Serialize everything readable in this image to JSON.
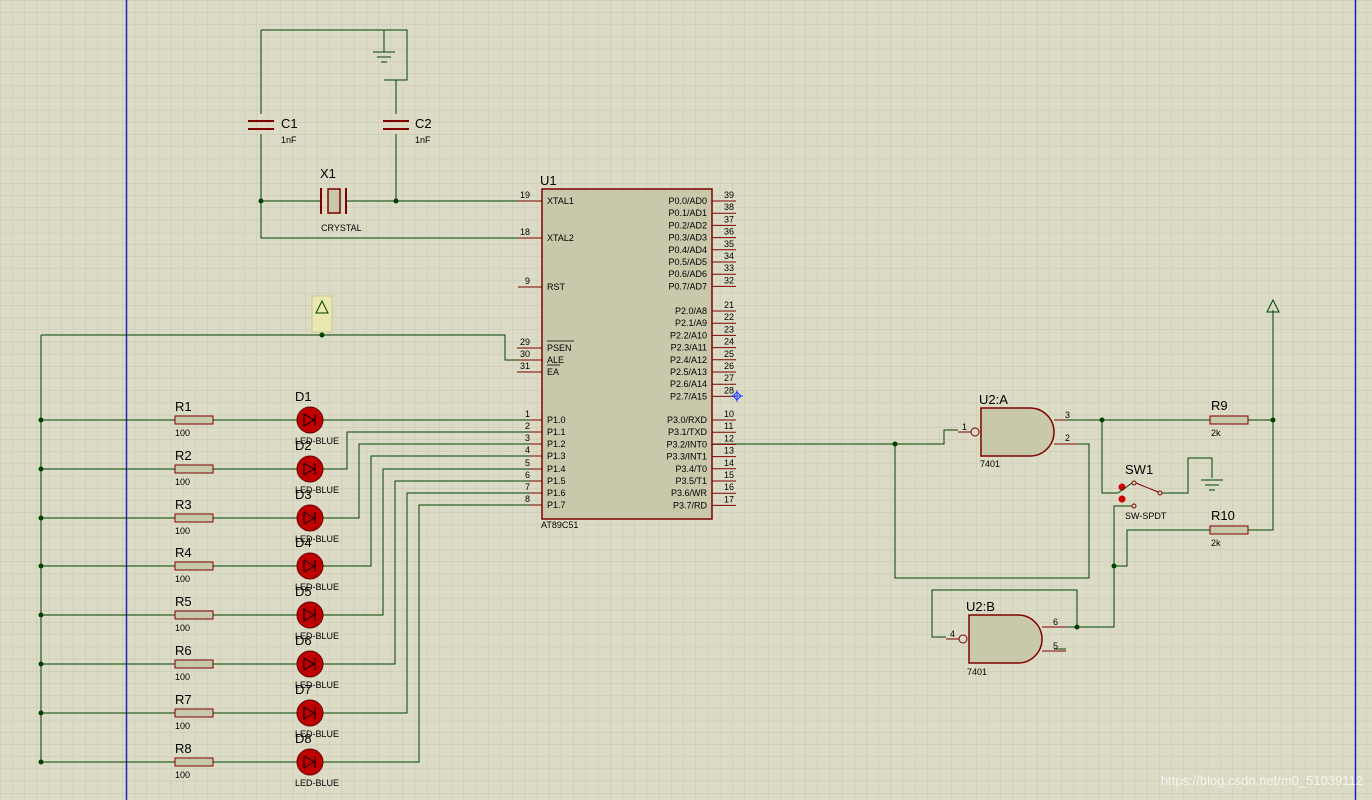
{
  "colors": {
    "background": "#dcdcc6",
    "grid": "#c8c8b4",
    "wire": "#004000",
    "body": "#c8c8aa",
    "outline": "#800000",
    "border": "#0000c0",
    "led": "#c00000"
  },
  "u1": {
    "ref": "U1",
    "part": "AT89C51",
    "left_pins": [
      {
        "num": "19",
        "name": "XTAL1"
      },
      {
        "num": "18",
        "name": "XTAL2"
      },
      {
        "num": "9",
        "name": "RST"
      },
      {
        "num": "29",
        "name": "PSEN"
      },
      {
        "num": "30",
        "name": "ALE"
      },
      {
        "num": "31",
        "name": "EA"
      },
      {
        "num": "1",
        "name": "P1.0"
      },
      {
        "num": "2",
        "name": "P1.1"
      },
      {
        "num": "3",
        "name": "P1.2"
      },
      {
        "num": "4",
        "name": "P1.3"
      },
      {
        "num": "5",
        "name": "P1.4"
      },
      {
        "num": "6",
        "name": "P1.5"
      },
      {
        "num": "7",
        "name": "P1.6"
      },
      {
        "num": "8",
        "name": "P1.7"
      }
    ],
    "right_pins": [
      {
        "num": "39",
        "name": "P0.0/AD0"
      },
      {
        "num": "38",
        "name": "P0.1/AD1"
      },
      {
        "num": "37",
        "name": "P0.2/AD2"
      },
      {
        "num": "36",
        "name": "P0.3/AD3"
      },
      {
        "num": "35",
        "name": "P0.4/AD4"
      },
      {
        "num": "34",
        "name": "P0.5/AD5"
      },
      {
        "num": "33",
        "name": "P0.6/AD6"
      },
      {
        "num": "32",
        "name": "P0.7/AD7"
      },
      {
        "num": "21",
        "name": "P2.0/A8"
      },
      {
        "num": "22",
        "name": "P2.1/A9"
      },
      {
        "num": "23",
        "name": "P2.2/A10"
      },
      {
        "num": "24",
        "name": "P2.3/A11"
      },
      {
        "num": "25",
        "name": "P2.4/A12"
      },
      {
        "num": "26",
        "name": "P2.5/A13"
      },
      {
        "num": "27",
        "name": "P2.6/A14"
      },
      {
        "num": "28",
        "name": "P2.7/A15"
      },
      {
        "num": "10",
        "name": "P3.0/RXD"
      },
      {
        "num": "11",
        "name": "P3.1/TXD"
      },
      {
        "num": "12",
        "name": "P3.2/INT0"
      },
      {
        "num": "13",
        "name": "P3.3/INT1"
      },
      {
        "num": "14",
        "name": "P3.4/T0"
      },
      {
        "num": "15",
        "name": "P3.5/T1"
      },
      {
        "num": "16",
        "name": "P3.6/WR"
      },
      {
        "num": "17",
        "name": "P3.7/RD"
      }
    ]
  },
  "x1": {
    "ref": "X1",
    "part": "CRYSTAL"
  },
  "c1": {
    "ref": "C1",
    "value": "1nF"
  },
  "c2": {
    "ref": "C2",
    "value": "1nF"
  },
  "resistors": [
    {
      "ref": "R1",
      "value": "100"
    },
    {
      "ref": "R2",
      "value": "100"
    },
    {
      "ref": "R3",
      "value": "100"
    },
    {
      "ref": "R4",
      "value": "100"
    },
    {
      "ref": "R5",
      "value": "100"
    },
    {
      "ref": "R6",
      "value": "100"
    },
    {
      "ref": "R7",
      "value": "100"
    },
    {
      "ref": "R8",
      "value": "100"
    }
  ],
  "leds": [
    {
      "ref": "D1",
      "part": "LED-BLUE"
    },
    {
      "ref": "D2",
      "part": "LED-BLUE"
    },
    {
      "ref": "D3",
      "part": "LED-BLUE"
    },
    {
      "ref": "D4",
      "part": "LED-BLUE"
    },
    {
      "ref": "D5",
      "part": "LED-BLUE"
    },
    {
      "ref": "D6",
      "part": "LED-BLUE"
    },
    {
      "ref": "D7",
      "part": "LED-BLUE"
    },
    {
      "ref": "D8",
      "part": "LED-BLUE"
    }
  ],
  "r9": {
    "ref": "R9",
    "value": "2k"
  },
  "r10": {
    "ref": "R10",
    "value": "2k"
  },
  "u2a": {
    "ref": "U2:A",
    "part": "7401",
    "in_pin": "1",
    "out_pin": "3",
    "side_pin": "2"
  },
  "u2b": {
    "ref": "U2:B",
    "part": "7401",
    "in_pin": "4",
    "out_pin": "6",
    "side_pin": "5"
  },
  "sw1": {
    "ref": "SW1",
    "part": "SW-SPDT"
  },
  "watermark": "https://blog.csdn.net/m0_51039112"
}
